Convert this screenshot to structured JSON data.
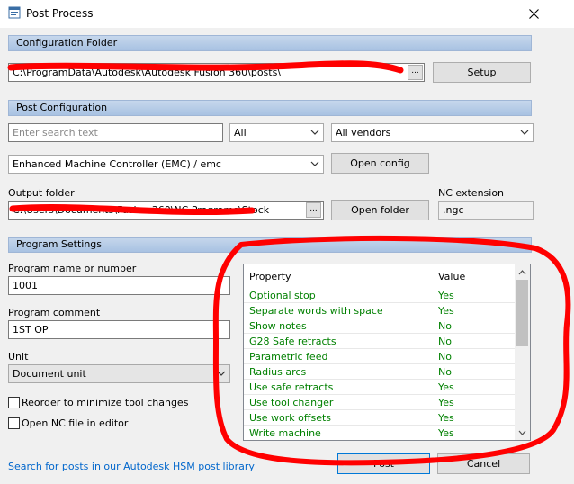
{
  "window": {
    "title": "Post Process"
  },
  "configuration_folder": {
    "section_label": "Configuration Folder",
    "path": "C:\\ProgramData\\Autodesk\\Autodesk Fusion 360\\posts\\",
    "browse_label": "...",
    "setup_label": "Setup"
  },
  "post_configuration": {
    "section_label": "Post Configuration",
    "search_placeholder": "Enter search text",
    "filter_value": "All",
    "vendor_value": "All vendors",
    "post_value": "Enhanced Machine Controller (EMC) / emc",
    "open_config_label": "Open config",
    "output_folder_label": "Output folder",
    "output_folder_path": "C:\\Users\\Documents\\Fusion 360\\NC Programs\\Stock",
    "output_browse_label": "...",
    "open_folder_label": "Open folder",
    "nc_extension_label": "NC extension",
    "nc_extension_value": ".ngc"
  },
  "program_settings": {
    "section_label": "Program Settings",
    "program_name_label": "Program name or number",
    "program_name_value": "1001",
    "program_comment_label": "Program comment",
    "program_comment_value": "1ST OP",
    "unit_label": "Unit",
    "unit_value": "Document unit",
    "reorder_label": "Reorder to minimize tool changes",
    "open_nc_label": "Open NC file in editor"
  },
  "properties": {
    "header_property": "Property",
    "header_value": "Value",
    "rows": [
      {
        "name": "Optional stop",
        "value": "Yes"
      },
      {
        "name": "Separate words with space",
        "value": "Yes"
      },
      {
        "name": "Show notes",
        "value": "No"
      },
      {
        "name": "G28 Safe retracts",
        "value": "No"
      },
      {
        "name": "Parametric feed",
        "value": "No"
      },
      {
        "name": "Radius arcs",
        "value": "No"
      },
      {
        "name": "Use safe retracts",
        "value": "Yes"
      },
      {
        "name": "Use tool changer",
        "value": "Yes"
      },
      {
        "name": "Use work offsets",
        "value": "Yes"
      },
      {
        "name": "Write machine",
        "value": "Yes"
      }
    ]
  },
  "footer": {
    "link_text": "Search for posts in our Autodesk HSM post library",
    "post_label": "Post",
    "cancel_label": "Cancel"
  },
  "colors": {
    "section_gradient_top": "#c6d7ec",
    "property_text": "#008000",
    "annotation_red": "#ff0000",
    "link": "#0066cc"
  },
  "icons": {
    "app": "post-process-app-icon",
    "close": "close-icon",
    "dropdown": "chevron-down-icon",
    "scroll_up": "scroll-up-arrow-icon",
    "scroll_down": "scroll-down-arrow-icon"
  }
}
